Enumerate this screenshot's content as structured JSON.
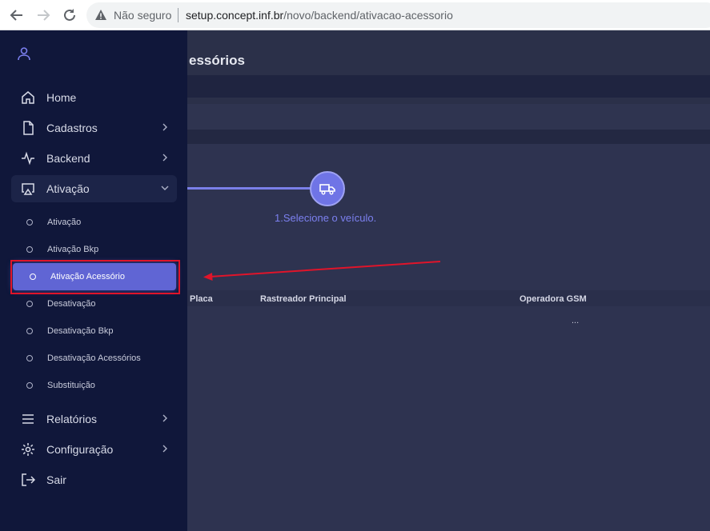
{
  "browser": {
    "not_secure_label": "Não seguro",
    "url_host": "setup.concept.inf.br",
    "url_path": "/novo/backend/ativacao-acessorio"
  },
  "page": {
    "title": "essórios"
  },
  "stepper": {
    "step_label": "1.Selecione o veículo."
  },
  "table": {
    "headers": [
      "Placa",
      "Rastreador Principal",
      "Operadora GSM"
    ],
    "empty_text": "..."
  },
  "sidebar": {
    "menu": [
      {
        "label": "Home",
        "icon": "home-icon"
      },
      {
        "label": "Cadastros",
        "icon": "file-icon"
      },
      {
        "label": "Backend",
        "icon": "activity-icon"
      },
      {
        "label": "Ativação",
        "icon": "airplay-icon"
      },
      {
        "label": "Relatórios",
        "icon": "menu-lines-icon"
      },
      {
        "label": "Configuração",
        "icon": "gear-icon"
      },
      {
        "label": "Sair",
        "icon": "logout-icon"
      }
    ],
    "submenu": [
      {
        "label": "Ativação"
      },
      {
        "label": "Ativação Bkp"
      },
      {
        "label": "Ativação Acessório"
      },
      {
        "label": "Desativação"
      },
      {
        "label": "Desativação Bkp"
      },
      {
        "label": "Desativação Acessórios"
      },
      {
        "label": "Substituição"
      }
    ],
    "active_submenu": "Ativação Acessório"
  },
  "colors": {
    "sidebar_bg": "#10173a",
    "accent": "#6065d4",
    "annotation": "#e0142a"
  }
}
